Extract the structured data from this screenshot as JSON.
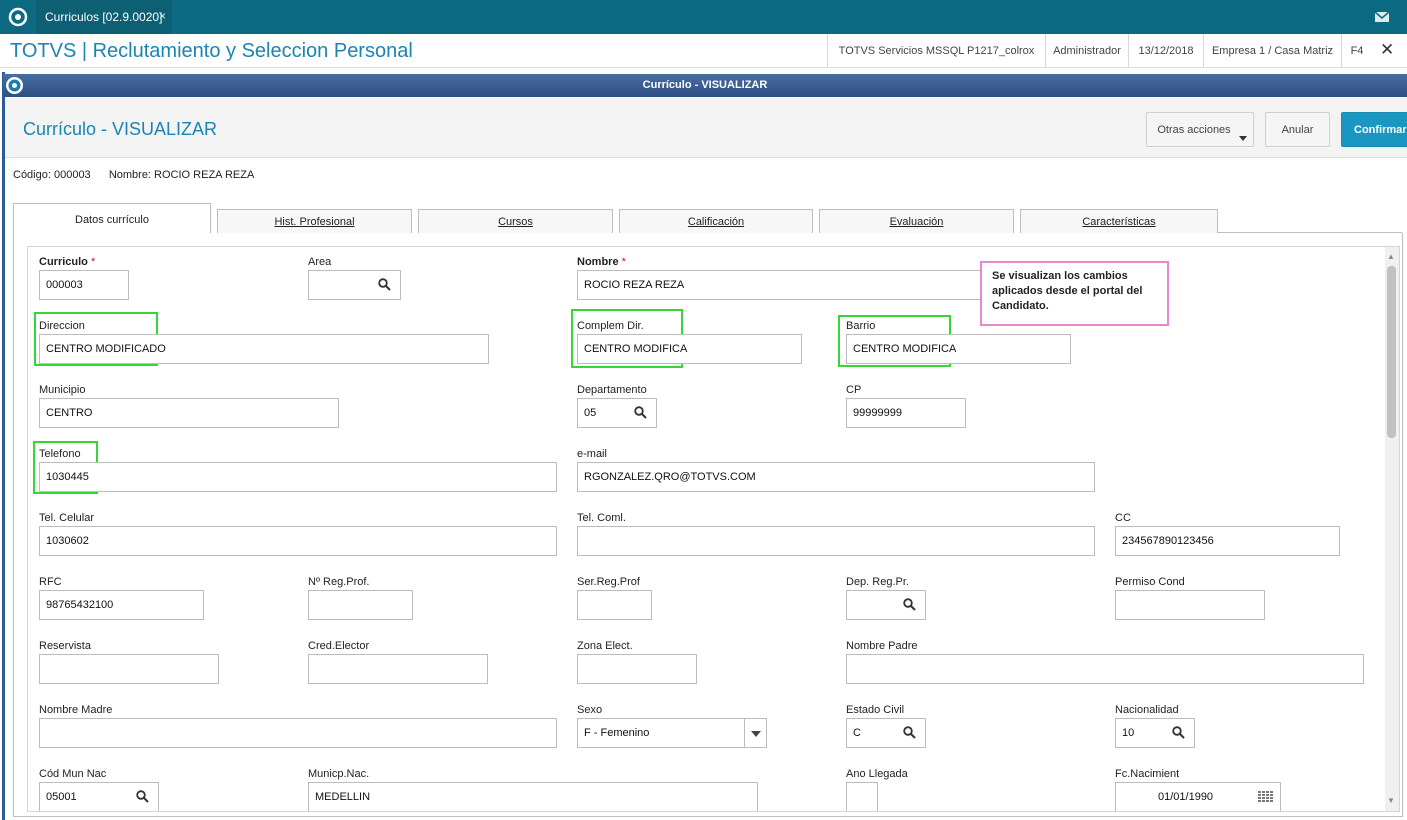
{
  "topbar": {
    "tab_title": "Curriculos [02.9.0020]",
    "close_symbol": "×"
  },
  "appbar": {
    "title": "TOTVS | Reclutamiento y Seleccion Personal",
    "environment": "TOTVS Servicios MSSQL P1217_colrox",
    "user": "Administrador",
    "date": "13/12/2018",
    "company": "Empresa 1 / Casa Matriz",
    "shortcut": "F4",
    "close_symbol": "✕"
  },
  "window": {
    "title": "Currículo - VISUALIZAR"
  },
  "header": {
    "title": "Currículo - VISUALIZAR",
    "other_actions": "Otras acciones",
    "cancel": "Anular",
    "confirm": "Confirmar"
  },
  "info": {
    "code": "Código: 000003",
    "name": "Nombre: ROCIO REZA REZA"
  },
  "tabs": [
    "Datos currículo",
    "Hist. Profesional",
    "Cursos",
    "Calificación",
    "Evaluación",
    "Características"
  ],
  "note": "Se visualizan los cambios aplicados desde el portal del Candidato.",
  "fields": {
    "curriculo": {
      "label": "Curriculo",
      "value": "000003",
      "required": "*"
    },
    "area": {
      "label": "Area",
      "value": ""
    },
    "nombre": {
      "label": "Nombre",
      "value": "ROCIO REZA REZA",
      "required": "*"
    },
    "direccion": {
      "label": "Direccion",
      "value": "CENTRO MODIFICADO"
    },
    "complem": {
      "label": "Complem Dir.",
      "value": "CENTRO MODIFICA"
    },
    "barrio": {
      "label": "Barrio",
      "value": "CENTRO MODIFICA"
    },
    "municipio": {
      "label": "Municipio",
      "value": "CENTRO"
    },
    "departamento": {
      "label": "Departamento",
      "value": "05"
    },
    "cp": {
      "label": "CP",
      "value": "99999999"
    },
    "telefono": {
      "label": "Telefono",
      "value": "1030445"
    },
    "email": {
      "label": "e-mail",
      "value": "RGONZALEZ.QRO@TOTVS.COM"
    },
    "celular": {
      "label": "Tel. Celular",
      "value": "1030602"
    },
    "telcoml": {
      "label": "Tel. Coml.",
      "value": ""
    },
    "cc": {
      "label": "CC",
      "value": "234567890123456"
    },
    "rfc": {
      "label": "RFC",
      "value": "98765432100"
    },
    "regprof": {
      "label": "Nº Reg.Prof.",
      "value": ""
    },
    "serreg": {
      "label": "Ser.Reg.Prof",
      "value": ""
    },
    "depreg": {
      "label": "Dep. Reg.Pr.",
      "value": ""
    },
    "permiso": {
      "label": "Permiso Cond",
      "value": ""
    },
    "reservista": {
      "label": "Reservista",
      "value": ""
    },
    "credelector": {
      "label": "Cred.Elector",
      "value": ""
    },
    "zonaelect": {
      "label": "Zona Elect.",
      "value": ""
    },
    "padre": {
      "label": "Nombre Padre",
      "value": ""
    },
    "madre": {
      "label": "Nombre Madre",
      "value": ""
    },
    "sexo": {
      "label": "Sexo",
      "value": "F - Femenino"
    },
    "estadocivil": {
      "label": "Estado Civil",
      "value": "C"
    },
    "nacionalidad": {
      "label": "Nacionalidad",
      "value": "10"
    },
    "codmun": {
      "label": "Cód Mun Nac",
      "value": "05001"
    },
    "municnac": {
      "label": "Municp.Nac.",
      "value": "MEDELLIN"
    },
    "anollegada": {
      "label": "Ano Llegada",
      "value": ""
    },
    "fcnac": {
      "label": "Fc.Nacimient",
      "value": "01/01/1990"
    }
  }
}
